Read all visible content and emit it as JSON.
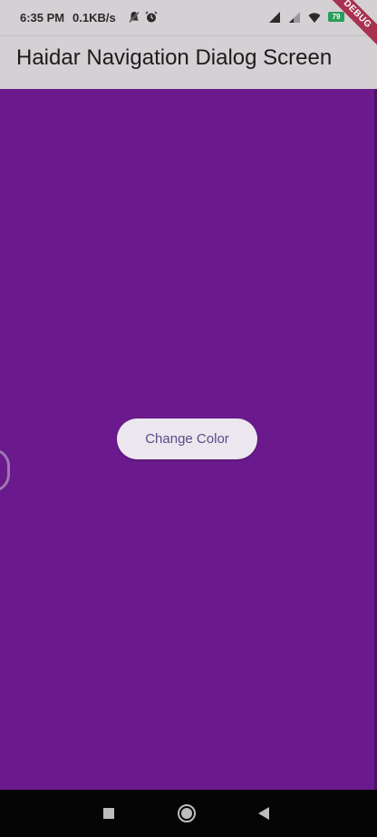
{
  "status_bar": {
    "time": "6:35 PM",
    "network_speed": "0.1KB/s",
    "battery_level": "79",
    "icons": [
      "mute-icon",
      "alarm-icon",
      "signal-icon",
      "signal-weak-icon",
      "battery-icon"
    ]
  },
  "app_bar": {
    "title": "Haidar Navigation Dialog Screen"
  },
  "debug_banner": {
    "label": "DEBUG"
  },
  "main": {
    "background_color": "#6a1a8c",
    "button_label": "Change Color"
  },
  "nav_bar": {
    "buttons": [
      "recents-button",
      "home-button",
      "back-button"
    ]
  }
}
